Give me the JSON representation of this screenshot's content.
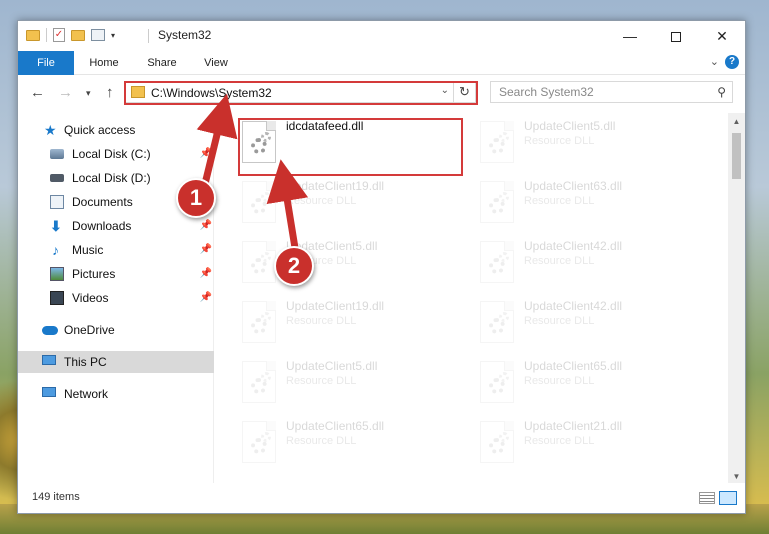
{
  "window": {
    "title": "System32",
    "min_glyph": "—",
    "close_glyph": "✕"
  },
  "quick_access_toolbar": {
    "dropdown_glyph": "▾"
  },
  "ribbon": {
    "tabs": [
      "File",
      "Home",
      "Share",
      "View"
    ],
    "collapse_glyph": "⌄",
    "help_glyph": "?"
  },
  "nav": {
    "back_glyph": "←",
    "forward_glyph": "→",
    "recent_glyph": "▾",
    "up_glyph": "↑",
    "address": "C:\\Windows\\System32",
    "address_dropdown_glyph": "⌄",
    "refresh_glyph": "↻",
    "search_placeholder": "Search System32",
    "search_glyph": "⚲"
  },
  "sidebar": {
    "items": [
      {
        "label": "Quick access",
        "icon": "star-icon",
        "glyph": "★"
      },
      {
        "label": "Local Disk (C:)",
        "icon": "disk-icon"
      },
      {
        "label": "Local Disk (D:)",
        "icon": "disk-icon"
      },
      {
        "label": "Documents",
        "icon": "documents-icon"
      },
      {
        "label": "Downloads",
        "icon": "downloads-icon",
        "glyph": "⬇"
      },
      {
        "label": "Music",
        "icon": "music-icon",
        "glyph": "♪"
      },
      {
        "label": "Pictures",
        "icon": "pictures-icon"
      },
      {
        "label": "Videos",
        "icon": "videos-icon"
      },
      {
        "label": "OneDrive",
        "icon": "onedrive-icon"
      },
      {
        "label": "This PC",
        "icon": "this-pc-icon"
      },
      {
        "label": "Network",
        "icon": "network-icon"
      }
    ],
    "pin_glyph": "📌"
  },
  "files": [
    {
      "name": "idcdatafeed.dll",
      "type": ""
    },
    {
      "name": "UpdateClient5.dll",
      "type": "Resource DLL"
    },
    {
      "name": "UpdateClient19.dll",
      "type": "Resource DLL"
    },
    {
      "name": "UpdateClient63.dll",
      "type": "Resource DLL"
    },
    {
      "name": "UpdateClient5.dll",
      "type": "Resource DLL"
    },
    {
      "name": "UpdateClient42.dll",
      "type": "Resource DLL"
    },
    {
      "name": "UpdateClient19.dll",
      "type": "Resource DLL"
    },
    {
      "name": "UpdateClient42.dll",
      "type": "Resource DLL"
    },
    {
      "name": "UpdateClient5.dll",
      "type": "Resource DLL"
    },
    {
      "name": "UpdateClient65.dll",
      "type": "Resource DLL"
    },
    {
      "name": "UpdateClient65.dll",
      "type": "Resource DLL"
    },
    {
      "name": "UpdateClient21.dll",
      "type": "Resource DLL"
    }
  ],
  "scrollbar": {
    "up_glyph": "▲",
    "down_glyph": "▼"
  },
  "status": {
    "item_count": "149 items"
  },
  "callouts": {
    "one": "1",
    "two": "2"
  },
  "colors": {
    "accent": "#1979ca",
    "highlight": "#d43a3a",
    "callout": "#c9302c"
  }
}
